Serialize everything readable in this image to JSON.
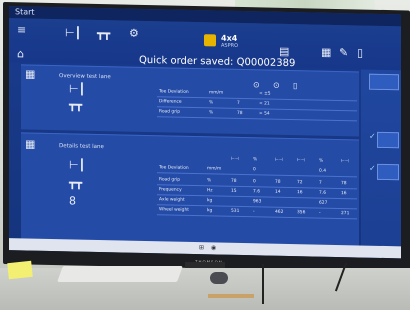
{
  "taskbar": {
    "start_label": "Start"
  },
  "brand_logo": {
    "title": "4x4",
    "subtitle": "ASPRO"
  },
  "banner": {
    "text": "Quick order saved: Q00002389"
  },
  "overview": {
    "title": "Overview test lane",
    "rows": [
      {
        "label": "Toe Deviation",
        "unit": "mm/m",
        "v1": "",
        "v2": "< ±5"
      },
      {
        "label": "Difference",
        "unit": "%",
        "v1": "7",
        "v2": "< 21"
      },
      {
        "label": "Road grip",
        "unit": "%",
        "v1": "78",
        "v2": "> 54"
      }
    ]
  },
  "details": {
    "title": "Details test lane",
    "rows": [
      {
        "label": "Toe Deviation",
        "unit": "mm/m",
        "cols": [
          "",
          "0",
          "",
          "",
          "0.4",
          ""
        ]
      },
      {
        "label": "Road grip",
        "unit": "%",
        "cols": [
          "78",
          "0",
          "78",
          "72",
          "7",
          "78"
        ]
      },
      {
        "label": "Frequency",
        "unit": "Hz",
        "cols": [
          "15",
          "7.6",
          "14",
          "16",
          "7.6",
          "16"
        ]
      },
      {
        "label": "Axle weight",
        "unit": "kg",
        "cols": [
          "",
          "963",
          "",
          "",
          "627",
          ""
        ]
      },
      {
        "label": "Wheel weight",
        "unit": "kg",
        "cols": [
          "531",
          "-",
          "462",
          "356",
          "-",
          "271"
        ]
      }
    ],
    "column_headers": [
      "⊢⊣",
      "%",
      "⊢⊣",
      "⊢⊣",
      "%",
      "⊢⊣"
    ]
  },
  "tv_brand": "THOMSON",
  "colors": {
    "screen_bg": "#1a3c8e",
    "accent": "#e7b400",
    "panel": "#244ba6"
  },
  "icons": [
    "menu-icon",
    "home-icon",
    "car-axle-icon",
    "lift-icon",
    "settings-icon",
    "printer-icon",
    "document-icon",
    "edit-icon",
    "delete-icon",
    "checkmark-icon",
    "windows-icon"
  ]
}
